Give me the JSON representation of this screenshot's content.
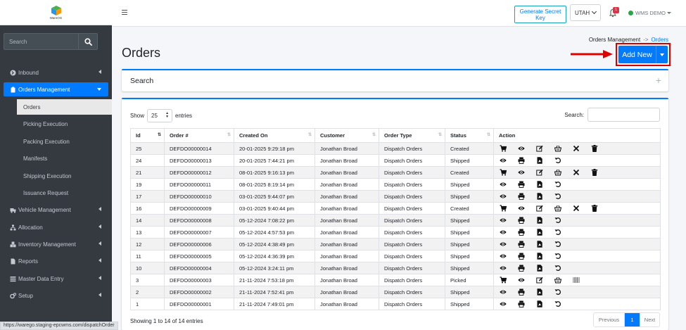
{
  "logo": {
    "text": "WareOG"
  },
  "sidebar": {
    "search_placeholder": "Search",
    "items": [
      {
        "label": "Inbound",
        "icon": "inbound-icon"
      },
      {
        "label": "Orders Management",
        "icon": "clipboard-icon",
        "active": true
      },
      {
        "label": "Vehicle Management",
        "icon": "truck-icon"
      },
      {
        "label": "Allocation",
        "icon": "sitemap-icon"
      },
      {
        "label": "Inventory Management",
        "icon": "boxes-icon"
      },
      {
        "label": "Reports",
        "icon": "file-icon"
      },
      {
        "label": "Master Data Entry",
        "icon": "list-icon"
      },
      {
        "label": "Setup",
        "icon": "cogs-icon"
      }
    ],
    "sub_items": [
      {
        "label": "Orders",
        "current": true
      },
      {
        "label": "Picking Execution"
      },
      {
        "label": "Packing Execution"
      },
      {
        "label": "Manifests"
      },
      {
        "label": "Shipping Execution"
      },
      {
        "label": "Issuance Request"
      }
    ]
  },
  "status_url": "https://warego.staging-epcwms.com/dispatchOrder",
  "topbar": {
    "generate_key_label": "Generate Secret Key",
    "location": "UTAH",
    "notification_count": "1",
    "user": "WMS DEMO"
  },
  "page": {
    "title": "Orders",
    "breadcrumb_parent": "Orders Management",
    "breadcrumb_sep": "->",
    "breadcrumb_current": "Orders",
    "add_new_label": "Add New"
  },
  "search_panel": {
    "title": "Search",
    "toggle": "+"
  },
  "table": {
    "show_label": "Show",
    "page_length": "25",
    "entries_label": "entries",
    "search_label": "Search:",
    "columns": [
      "Id",
      "Order #",
      "Created On",
      "Customer",
      "Order Type",
      "Status",
      "Action"
    ],
    "rows": [
      {
        "id": "25",
        "order": "DEFDO00000014",
        "created": "20-01-2025 9:29:18 pm",
        "customer": "Jonathan Broad",
        "type": "Dispatch Orders",
        "status": "Created",
        "actions": [
          "cart",
          "eye",
          "edit",
          "basket",
          "cross",
          "trash"
        ]
      },
      {
        "id": "24",
        "order": "DEFDO00000013",
        "created": "20-01-2025 7:44:21 pm",
        "customer": "Jonathan Broad",
        "type": "Dispatch Orders",
        "status": "Shipped",
        "actions": [
          "eye",
          "print",
          "pdf",
          "undo"
        ]
      },
      {
        "id": "21",
        "order": "DEFDO00000012",
        "created": "08-01-2025 9:16:13 pm",
        "customer": "Jonathan Broad",
        "type": "Dispatch Orders",
        "status": "Created",
        "actions": [
          "cart",
          "eye",
          "edit",
          "basket",
          "cross",
          "trash"
        ]
      },
      {
        "id": "19",
        "order": "DEFDO00000011",
        "created": "08-01-2025 8:19:14 pm",
        "customer": "Jonathan Broad",
        "type": "Dispatch Orders",
        "status": "Shipped",
        "actions": [
          "eye",
          "print",
          "pdf",
          "undo"
        ]
      },
      {
        "id": "17",
        "order": "DEFDO00000010",
        "created": "03-01-2025 9:44:07 pm",
        "customer": "Jonathan Broad",
        "type": "Dispatch Orders",
        "status": "Shipped",
        "actions": [
          "eye",
          "print",
          "pdf",
          "undo"
        ]
      },
      {
        "id": "16",
        "order": "DEFDO00000009",
        "created": "03-01-2025 9:40:44 pm",
        "customer": "Jonathan Broad",
        "type": "Dispatch Orders",
        "status": "Created",
        "actions": [
          "cart",
          "eye",
          "edit",
          "basket",
          "cross",
          "trash"
        ]
      },
      {
        "id": "14",
        "order": "DEFDO00000008",
        "created": "05-12-2024 7:08:22 pm",
        "customer": "Jonathan Broad",
        "type": "Dispatch Orders",
        "status": "Shipped",
        "actions": [
          "eye",
          "print",
          "pdf",
          "undo"
        ]
      },
      {
        "id": "13",
        "order": "DEFDO00000007",
        "created": "05-12-2024 4:57:53 pm",
        "customer": "Jonathan Broad",
        "type": "Dispatch Orders",
        "status": "Shipped",
        "actions": [
          "eye",
          "print",
          "pdf",
          "undo"
        ]
      },
      {
        "id": "12",
        "order": "DEFDO00000006",
        "created": "05-12-2024 4:38:49 pm",
        "customer": "Jonathan Broad",
        "type": "Dispatch Orders",
        "status": "Shipped",
        "actions": [
          "eye",
          "print",
          "pdf",
          "undo"
        ]
      },
      {
        "id": "11",
        "order": "DEFDO00000005",
        "created": "05-12-2024 4:36:39 pm",
        "customer": "Jonathan Broad",
        "type": "Dispatch Orders",
        "status": "Shipped",
        "actions": [
          "eye",
          "print",
          "pdf",
          "undo"
        ]
      },
      {
        "id": "10",
        "order": "DEFDO00000004",
        "created": "05-12-2024 3:24:11 pm",
        "customer": "Jonathan Broad",
        "type": "Dispatch Orders",
        "status": "Shipped",
        "actions": [
          "eye",
          "print",
          "pdf",
          "undo"
        ]
      },
      {
        "id": "3",
        "order": "DEFDO00000003",
        "created": "21-11-2024 7:53:18 pm",
        "customer": "Jonathan Broad",
        "type": "Dispatch Orders",
        "status": "Picked",
        "actions": [
          "cart",
          "eye",
          "edit",
          "basket",
          "barcode"
        ]
      },
      {
        "id": "2",
        "order": "DEFDO00000002",
        "created": "21-11-2024 7:52:41 pm",
        "customer": "Jonathan Broad",
        "type": "Dispatch Orders",
        "status": "Shipped",
        "actions": [
          "eye",
          "print",
          "pdf",
          "undo"
        ]
      },
      {
        "id": "1",
        "order": "DEFDO00000001",
        "created": "21-11-2024 7:49:01 pm",
        "customer": "Jonathan Broad",
        "type": "Dispatch Orders",
        "status": "Shipped",
        "actions": [
          "eye",
          "print",
          "pdf",
          "undo"
        ]
      }
    ],
    "info": "Showing 1 to 14 of 14 entries",
    "pager": {
      "previous": "Previous",
      "current": "1",
      "next": "Next"
    }
  },
  "colors": {
    "primary": "#007bff",
    "sidebar_bg": "#343a40",
    "highlight": "#d50000",
    "success": "#28a745",
    "danger": "#dc3545"
  }
}
